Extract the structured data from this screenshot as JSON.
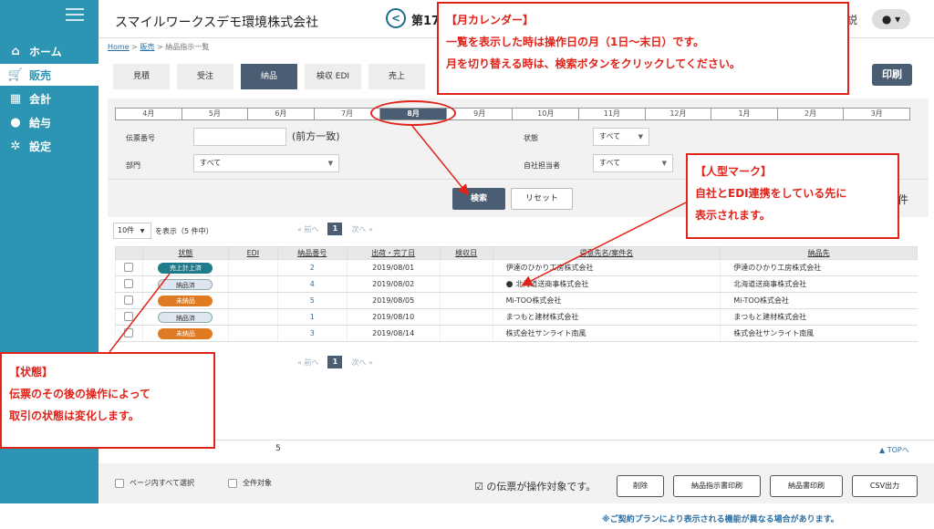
{
  "sidebar": {
    "items": [
      {
        "icon": "home-icon",
        "label": "ホーム"
      },
      {
        "icon": "cart-icon",
        "label": "販売"
      },
      {
        "icon": "calculator-icon",
        "label": "会計"
      },
      {
        "icon": "money-bag-icon",
        "label": "給与"
      },
      {
        "icon": "gear-icon",
        "label": "設定"
      }
    ]
  },
  "header": {
    "company": "スマイルワークスデモ環境株式会社",
    "period": "第17",
    "help": "説",
    "user_icon": "user-icon",
    "user_caret": "▾"
  },
  "breadcrumb": {
    "home": "Home",
    "sep": ">",
    "sales": "販売",
    "current": "納品指示一覧"
  },
  "tabs": [
    "見積",
    "受注",
    "納品",
    "検収 EDI",
    "売上"
  ],
  "print_label": "印刷",
  "months": [
    "4月",
    "5月",
    "6月",
    "7月",
    "8月",
    "9月",
    "10月",
    "11月",
    "12月",
    "1月",
    "2月",
    "3月"
  ],
  "filters": {
    "slip_no_label": "伝票番号",
    "slip_no_note": "(前方一致)",
    "dept_label": "部門",
    "dept_value": "すべて",
    "status_label": "状態",
    "status_value": "すべて",
    "staff_label": "自社担当者",
    "staff_value": "すべて",
    "search_label": "検索",
    "reset_label": "リセット",
    "count_tail": "件"
  },
  "list": {
    "per_page": "10件",
    "per_page_text": "を表示（5 件中）",
    "prev": "« 前へ",
    "page": "1",
    "next": "次へ »",
    "headers": [
      "状態",
      "EDI",
      "納品番号",
      "出荷・完了日",
      "検収日",
      "得意先名/案件名",
      "納品先"
    ],
    "rows": [
      {
        "status": "売上計上済",
        "edi": "",
        "no": "2",
        "date": "2019/08/01",
        "accepted": "",
        "customer": "伊達のひかり工房株式会社",
        "dest": "伊達のひかり工房株式会社"
      },
      {
        "status": "納品済",
        "edi": "",
        "no": "4",
        "date": "2019/08/02",
        "accepted": "",
        "customer": "北海道送商事株式会社",
        "dest": "北海道送商事株式会社"
      },
      {
        "status": "未納品",
        "edi": "",
        "no": "5",
        "date": "2019/08/05",
        "accepted": "",
        "customer": "Mi-TOO株式会社",
        "dest": "Mi-TOO株式会社"
      },
      {
        "status": "納品済",
        "edi": "",
        "no": "1",
        "date": "2019/08/10",
        "accepted": "",
        "customer": "まつもと建材株式会社",
        "dest": "まつもと建材株式会社"
      },
      {
        "status": "未納品",
        "edi": "",
        "no": "3",
        "date": "2019/08/14",
        "accepted": "",
        "customer": "株式会社サンライト南風",
        "dest": "株式会社サンライト南風"
      }
    ]
  },
  "footer": {
    "total": "5",
    "top_link": "▲ TOPへ",
    "select_page": "ページ内すべて選択",
    "select_all": "全件対象",
    "ops_text": "☑ の伝票が操作対象です。",
    "delete": "削除",
    "print_instruction": "納品指示書印刷",
    "print_delivery": "納品書印刷",
    "csv": "CSV出力",
    "plan_note": "※ご契約プランにより表示される機能が異なる場合があります。"
  },
  "callouts": {
    "month": {
      "title": "【月カレンダー】",
      "line1": "一覧を表示した時は操作日の月（1日～末日）です。",
      "line2": "月を切り替える時は、検索ボタンをクリックしてください。"
    },
    "person": {
      "title": "【人型マーク】",
      "line1": "自社とEDI連携をしている先に",
      "line2": "表示されます。"
    },
    "status": {
      "title": "【状態】",
      "line1": "伝票のその後の操作によって",
      "line2": "取引の状態は変化します。"
    }
  },
  "colors": {
    "sidebar": "#2b95b3",
    "primary_button": "#4a5d72",
    "callout": "#e2231a",
    "badge_teal": "#1f7a8c",
    "badge_orange": "#e07a22"
  }
}
